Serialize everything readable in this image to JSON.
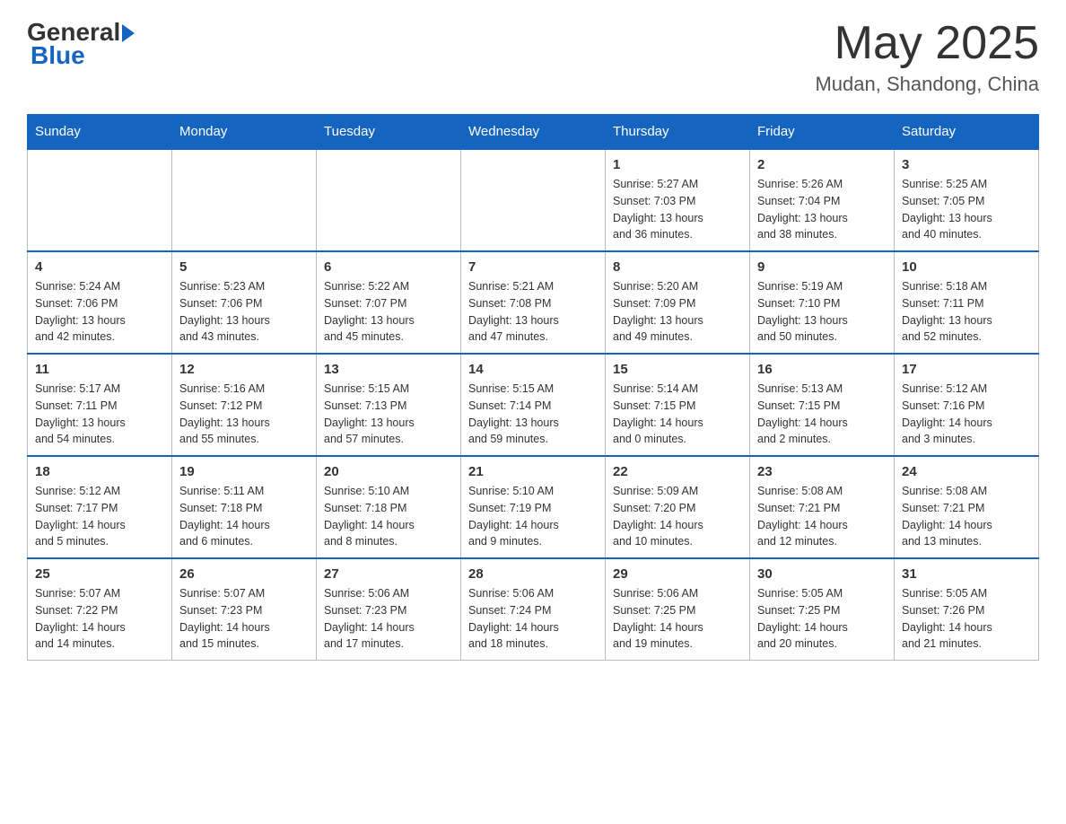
{
  "header": {
    "logo_general": "General",
    "logo_blue": "Blue",
    "month_year": "May 2025",
    "location": "Mudan, Shandong, China"
  },
  "weekdays": [
    "Sunday",
    "Monday",
    "Tuesday",
    "Wednesday",
    "Thursday",
    "Friday",
    "Saturday"
  ],
  "weeks": [
    [
      {
        "day": "",
        "info": ""
      },
      {
        "day": "",
        "info": ""
      },
      {
        "day": "",
        "info": ""
      },
      {
        "day": "",
        "info": ""
      },
      {
        "day": "1",
        "info": "Sunrise: 5:27 AM\nSunset: 7:03 PM\nDaylight: 13 hours\nand 36 minutes."
      },
      {
        "day": "2",
        "info": "Sunrise: 5:26 AM\nSunset: 7:04 PM\nDaylight: 13 hours\nand 38 minutes."
      },
      {
        "day": "3",
        "info": "Sunrise: 5:25 AM\nSunset: 7:05 PM\nDaylight: 13 hours\nand 40 minutes."
      }
    ],
    [
      {
        "day": "4",
        "info": "Sunrise: 5:24 AM\nSunset: 7:06 PM\nDaylight: 13 hours\nand 42 minutes."
      },
      {
        "day": "5",
        "info": "Sunrise: 5:23 AM\nSunset: 7:06 PM\nDaylight: 13 hours\nand 43 minutes."
      },
      {
        "day": "6",
        "info": "Sunrise: 5:22 AM\nSunset: 7:07 PM\nDaylight: 13 hours\nand 45 minutes."
      },
      {
        "day": "7",
        "info": "Sunrise: 5:21 AM\nSunset: 7:08 PM\nDaylight: 13 hours\nand 47 minutes."
      },
      {
        "day": "8",
        "info": "Sunrise: 5:20 AM\nSunset: 7:09 PM\nDaylight: 13 hours\nand 49 minutes."
      },
      {
        "day": "9",
        "info": "Sunrise: 5:19 AM\nSunset: 7:10 PM\nDaylight: 13 hours\nand 50 minutes."
      },
      {
        "day": "10",
        "info": "Sunrise: 5:18 AM\nSunset: 7:11 PM\nDaylight: 13 hours\nand 52 minutes."
      }
    ],
    [
      {
        "day": "11",
        "info": "Sunrise: 5:17 AM\nSunset: 7:11 PM\nDaylight: 13 hours\nand 54 minutes."
      },
      {
        "day": "12",
        "info": "Sunrise: 5:16 AM\nSunset: 7:12 PM\nDaylight: 13 hours\nand 55 minutes."
      },
      {
        "day": "13",
        "info": "Sunrise: 5:15 AM\nSunset: 7:13 PM\nDaylight: 13 hours\nand 57 minutes."
      },
      {
        "day": "14",
        "info": "Sunrise: 5:15 AM\nSunset: 7:14 PM\nDaylight: 13 hours\nand 59 minutes."
      },
      {
        "day": "15",
        "info": "Sunrise: 5:14 AM\nSunset: 7:15 PM\nDaylight: 14 hours\nand 0 minutes."
      },
      {
        "day": "16",
        "info": "Sunrise: 5:13 AM\nSunset: 7:15 PM\nDaylight: 14 hours\nand 2 minutes."
      },
      {
        "day": "17",
        "info": "Sunrise: 5:12 AM\nSunset: 7:16 PM\nDaylight: 14 hours\nand 3 minutes."
      }
    ],
    [
      {
        "day": "18",
        "info": "Sunrise: 5:12 AM\nSunset: 7:17 PM\nDaylight: 14 hours\nand 5 minutes."
      },
      {
        "day": "19",
        "info": "Sunrise: 5:11 AM\nSunset: 7:18 PM\nDaylight: 14 hours\nand 6 minutes."
      },
      {
        "day": "20",
        "info": "Sunrise: 5:10 AM\nSunset: 7:18 PM\nDaylight: 14 hours\nand 8 minutes."
      },
      {
        "day": "21",
        "info": "Sunrise: 5:10 AM\nSunset: 7:19 PM\nDaylight: 14 hours\nand 9 minutes."
      },
      {
        "day": "22",
        "info": "Sunrise: 5:09 AM\nSunset: 7:20 PM\nDaylight: 14 hours\nand 10 minutes."
      },
      {
        "day": "23",
        "info": "Sunrise: 5:08 AM\nSunset: 7:21 PM\nDaylight: 14 hours\nand 12 minutes."
      },
      {
        "day": "24",
        "info": "Sunrise: 5:08 AM\nSunset: 7:21 PM\nDaylight: 14 hours\nand 13 minutes."
      }
    ],
    [
      {
        "day": "25",
        "info": "Sunrise: 5:07 AM\nSunset: 7:22 PM\nDaylight: 14 hours\nand 14 minutes."
      },
      {
        "day": "26",
        "info": "Sunrise: 5:07 AM\nSunset: 7:23 PM\nDaylight: 14 hours\nand 15 minutes."
      },
      {
        "day": "27",
        "info": "Sunrise: 5:06 AM\nSunset: 7:23 PM\nDaylight: 14 hours\nand 17 minutes."
      },
      {
        "day": "28",
        "info": "Sunrise: 5:06 AM\nSunset: 7:24 PM\nDaylight: 14 hours\nand 18 minutes."
      },
      {
        "day": "29",
        "info": "Sunrise: 5:06 AM\nSunset: 7:25 PM\nDaylight: 14 hours\nand 19 minutes."
      },
      {
        "day": "30",
        "info": "Sunrise: 5:05 AM\nSunset: 7:25 PM\nDaylight: 14 hours\nand 20 minutes."
      },
      {
        "day": "31",
        "info": "Sunrise: 5:05 AM\nSunset: 7:26 PM\nDaylight: 14 hours\nand 21 minutes."
      }
    ]
  ]
}
